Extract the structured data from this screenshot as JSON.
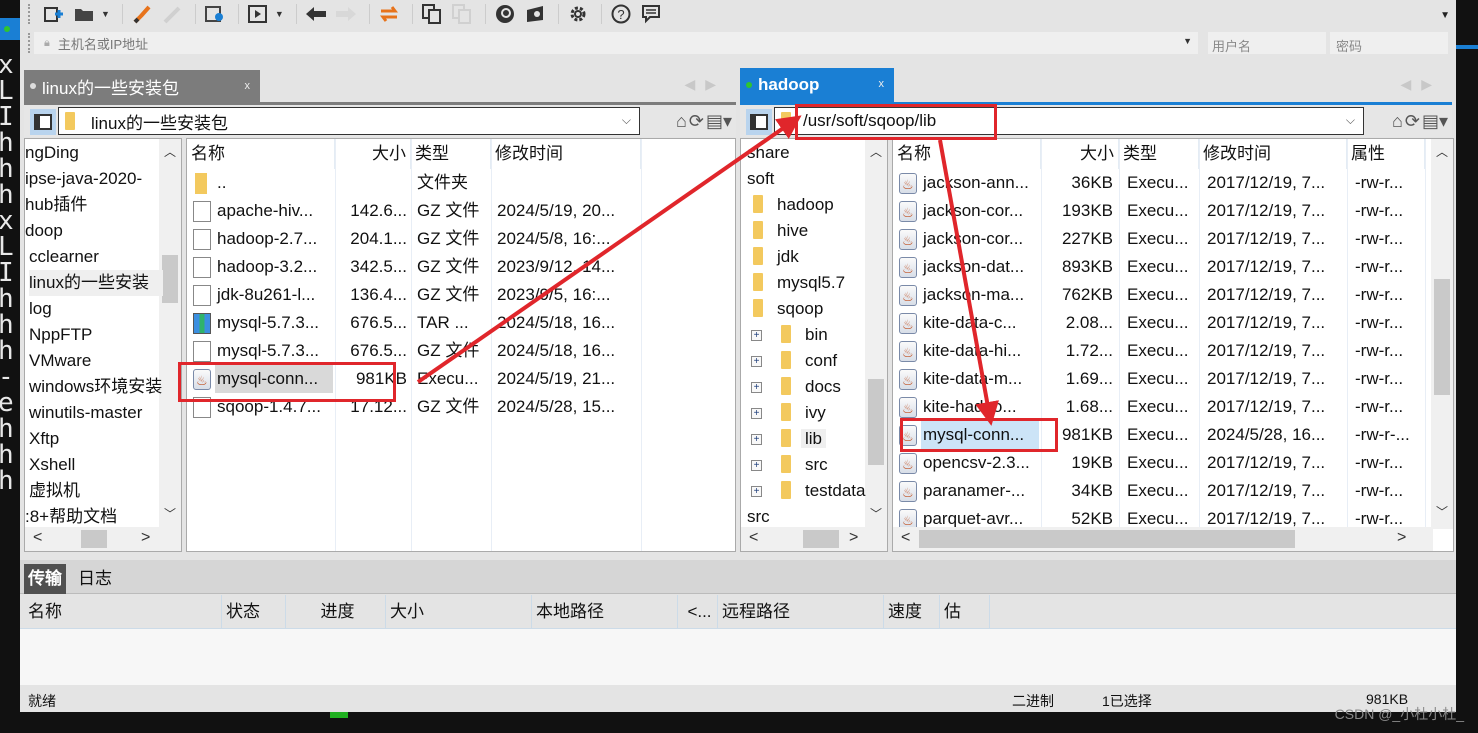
{
  "toolbar": {
    "icons": [
      {
        "name": "new-session-icon",
        "glyph": "⊞"
      },
      {
        "name": "open-folder-icon",
        "glyph": "▬"
      },
      {
        "name": "connect-icon",
        "glyph": "⚡"
      },
      {
        "name": "disconnect-icon",
        "glyph": "⚡"
      },
      {
        "name": "properties-icon",
        "glyph": "⚙"
      },
      {
        "name": "play-icon",
        "glyph": "▶"
      },
      {
        "name": "back-icon",
        "glyph": "◀"
      },
      {
        "name": "forward-icon",
        "glyph": "▶"
      },
      {
        "name": "sync-icon",
        "glyph": "⇄"
      },
      {
        "name": "copy-icon",
        "glyph": "❐"
      },
      {
        "name": "paste-icon",
        "glyph": "❐"
      },
      {
        "name": "xshell-icon",
        "glyph": "◉"
      },
      {
        "name": "xftp-icon",
        "glyph": "◈"
      },
      {
        "name": "settings-icon",
        "glyph": "⚙"
      },
      {
        "name": "help-icon",
        "glyph": "?"
      },
      {
        "name": "feedback-icon",
        "glyph": "▭"
      }
    ]
  },
  "address": {
    "host_placeholder": "主机名或IP地址",
    "user_placeholder": "用户名",
    "password_placeholder": "密码"
  },
  "left_pane": {
    "tab_label": "linux的一些安装包",
    "tab_close": "x",
    "path": "linux的一些安装包",
    "tree": [
      {
        "label": "ngDing",
        "indent": 0
      },
      {
        "label": "ipse-java-2020-",
        "indent": 0
      },
      {
        "label": "hub插件",
        "indent": 0
      },
      {
        "label": "doop",
        "indent": 0
      },
      {
        "label": "cclearner",
        "indent": 1
      },
      {
        "label": "linux的一些安装",
        "indent": 1,
        "selected": true
      },
      {
        "label": "log",
        "indent": 1
      },
      {
        "label": "NppFTP",
        "indent": 1
      },
      {
        "label": "VMware",
        "indent": 1
      },
      {
        "label": "windows环境安装",
        "indent": 1
      },
      {
        "label": "winutils-master",
        "indent": 1
      },
      {
        "label": "Xftp",
        "indent": 1
      },
      {
        "label": "Xshell",
        "indent": 1
      },
      {
        "label": "虚拟机",
        "indent": 1
      },
      {
        "label": ":8+帮助文档",
        "indent": 0
      }
    ],
    "columns": [
      "名称",
      "大小",
      "类型",
      "修改时间"
    ],
    "files": [
      {
        "icon": "folder",
        "name": "..",
        "size": "",
        "type": "文件夹",
        "modified": ""
      },
      {
        "icon": "doc",
        "name": "apache-hiv...",
        "size": "142.6...",
        "type": "GZ 文件",
        "modified": "2024/5/19, 20..."
      },
      {
        "icon": "doc",
        "name": "hadoop-2.7...",
        "size": "204.1...",
        "type": "GZ 文件",
        "modified": "2024/5/8, 16:..."
      },
      {
        "icon": "doc",
        "name": "hadoop-3.2...",
        "size": "342.5...",
        "type": "GZ 文件",
        "modified": "2023/9/12, 14..."
      },
      {
        "icon": "doc",
        "name": "jdk-8u261-l...",
        "size": "136.4...",
        "type": "GZ 文件",
        "modified": "2023/9/5, 16:..."
      },
      {
        "icon": "rar",
        "name": "mysql-5.7.3...",
        "size": "676.5...",
        "type": "TAR ...",
        "modified": "2024/5/18, 16..."
      },
      {
        "icon": "doc",
        "name": "mysql-5.7.3...",
        "size": "676.5...",
        "type": "GZ 文件",
        "modified": "2024/5/18, 16..."
      },
      {
        "icon": "jar",
        "name": "mysql-conn...",
        "size": "981KB",
        "type": "Execu...",
        "modified": "2024/5/19, 21...",
        "highlight": true
      },
      {
        "icon": "doc",
        "name": "sqoop-1.4.7...",
        "size": "17.12...",
        "type": "GZ 文件",
        "modified": "2024/5/28, 15..."
      }
    ]
  },
  "right_pane": {
    "tab_label": "hadoop",
    "tab_close": "x",
    "path": "/usr/soft/sqoop/lib",
    "tree": [
      {
        "label": "share",
        "level": 0
      },
      {
        "label": "soft",
        "level": 0
      },
      {
        "label": "hadoop",
        "level": 1
      },
      {
        "label": "hive",
        "level": 1
      },
      {
        "label": "jdk",
        "level": 1
      },
      {
        "label": "mysql5.7",
        "level": 1
      },
      {
        "label": "sqoop",
        "level": 1
      },
      {
        "label": "bin",
        "level": 2
      },
      {
        "label": "conf",
        "level": 2
      },
      {
        "label": "docs",
        "level": 2
      },
      {
        "label": "ivy",
        "level": 2
      },
      {
        "label": "lib",
        "level": 2,
        "selected": true
      },
      {
        "label": "src",
        "level": 2
      },
      {
        "label": "testdata",
        "level": 2
      },
      {
        "label": "src",
        "level": 0
      }
    ],
    "columns": [
      "名称",
      "大小",
      "类型",
      "修改时间",
      "属性"
    ],
    "files": [
      {
        "name": "jackson-ann...",
        "size": "36KB",
        "type": "Execu...",
        "modified": "2017/12/19, 7...",
        "attr": "-rw-r..."
      },
      {
        "name": "jackson-cor...",
        "size": "193KB",
        "type": "Execu...",
        "modified": "2017/12/19, 7...",
        "attr": "-rw-r..."
      },
      {
        "name": "jackson-cor...",
        "size": "227KB",
        "type": "Execu...",
        "modified": "2017/12/19, 7...",
        "attr": "-rw-r..."
      },
      {
        "name": "jackson-dat...",
        "size": "893KB",
        "type": "Execu...",
        "modified": "2017/12/19, 7...",
        "attr": "-rw-r..."
      },
      {
        "name": "jackson-ma...",
        "size": "762KB",
        "type": "Execu...",
        "modified": "2017/12/19, 7...",
        "attr": "-rw-r..."
      },
      {
        "name": "kite-data-c...",
        "size": "2.08...",
        "type": "Execu...",
        "modified": "2017/12/19, 7...",
        "attr": "-rw-r..."
      },
      {
        "name": "kite-data-hi...",
        "size": "1.72...",
        "type": "Execu...",
        "modified": "2017/12/19, 7...",
        "attr": "-rw-r..."
      },
      {
        "name": "kite-data-m...",
        "size": "1.69...",
        "type": "Execu...",
        "modified": "2017/12/19, 7...",
        "attr": "-rw-r..."
      },
      {
        "name": "kite-hadoo...",
        "size": "1.68...",
        "type": "Execu...",
        "modified": "2017/12/19, 7...",
        "attr": "-rw-r..."
      },
      {
        "name": "mysql-conn...",
        "size": "981KB",
        "type": "Execu...",
        "modified": "2024/5/28, 16...",
        "attr": "-rw-r-...",
        "selected": true
      },
      {
        "name": "opencsv-2.3...",
        "size": "19KB",
        "type": "Execu...",
        "modified": "2017/12/19, 7...",
        "attr": "-rw-r..."
      },
      {
        "name": "paranamer-...",
        "size": "34KB",
        "type": "Execu...",
        "modified": "2017/12/19, 7...",
        "attr": "-rw-r..."
      },
      {
        "name": "parquet-avr...",
        "size": "52KB",
        "type": "Execu...",
        "modified": "2017/12/19, 7...",
        "attr": "-rw-r..."
      }
    ]
  },
  "transfer": {
    "tabs": [
      "传输",
      "日志"
    ],
    "columns": [
      "名称",
      "状态",
      "进度",
      "大小",
      "本地路径",
      "<...",
      "远程路径",
      "速度",
      "估计..."
    ]
  },
  "status_bar": {
    "state": "就绪",
    "mode": "二进制",
    "selected": "1已选择",
    "size": "981KB"
  },
  "background_terminal": {
    "lines": [
      "x",
      "L",
      "I",
      "h",
      "h",
      "h",
      "x",
      "L",
      "I",
      "h",
      "h",
      "h",
      "-",
      "e",
      "h",
      "h",
      "h"
    ]
  },
  "watermark": "CSDN @_小杜小杜_",
  "colors": {
    "accent": "#1a7fd4",
    "annotation_red": "#e0262b",
    "inactive_tab": "#7c7c7c",
    "connected_dot": "#2fc52f"
  }
}
